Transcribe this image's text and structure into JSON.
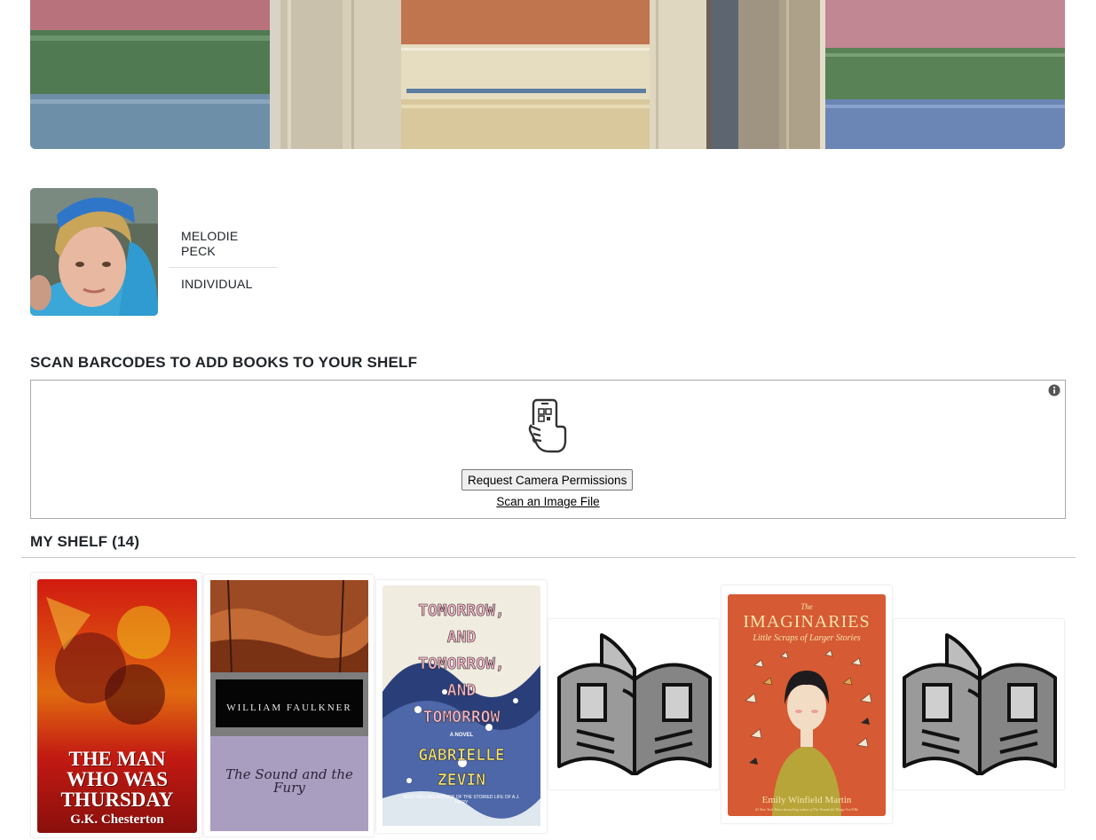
{
  "profile": {
    "name": "MELODIE PECK",
    "account_type": "INDIVIDUAL"
  },
  "scanner": {
    "heading": "SCAN BARCODES TO ADD BOOKS TO YOUR SHELF",
    "request_camera_label": "Request Camera Permissions",
    "scan_file_label": "Scan an Image File",
    "info_icon": "info-circle-icon",
    "phone_icon": "phone-scan-icon"
  },
  "shelf": {
    "heading": "MY SHELF (14)",
    "books": [
      {
        "title_lines": [
          "THE MAN",
          "WHO WAS",
          "THURSDAY"
        ],
        "author": "G.K. Chesterton",
        "cover": "image"
      },
      {
        "title_script": "The Sound and the Fury",
        "author": "WILLIAM FAULKNER",
        "cover": "image"
      },
      {
        "title_lines": [
          "TOMORROW,",
          "AND",
          "TOMORROW,",
          "AND",
          "TOMORROW"
        ],
        "tagline": "A NOVEL",
        "author_lines": [
          "GABRIELLE",
          "ZEVIN"
        ],
        "blurb": "BEST-SELLING AUTHOR OF THE STORIED LIFE OF A.J. FIKRY",
        "cover": "image"
      },
      {
        "cover": "placeholder",
        "icon": "open-book-icon"
      },
      {
        "title_small": "The",
        "title": "IMAGINARIES",
        "subtitle": "Little Scraps of Larger Stories",
        "author": "Emily Winfield Martin",
        "blurb": "#1 New York Times bestselling author of The Wonderful Things You'll Be",
        "cover": "image"
      },
      {
        "cover": "placeholder",
        "icon": "open-book-icon"
      }
    ]
  },
  "colors": {
    "text": "#212529",
    "border": "#a9a9a9",
    "placeholder_gray": "#9a9a9a"
  }
}
